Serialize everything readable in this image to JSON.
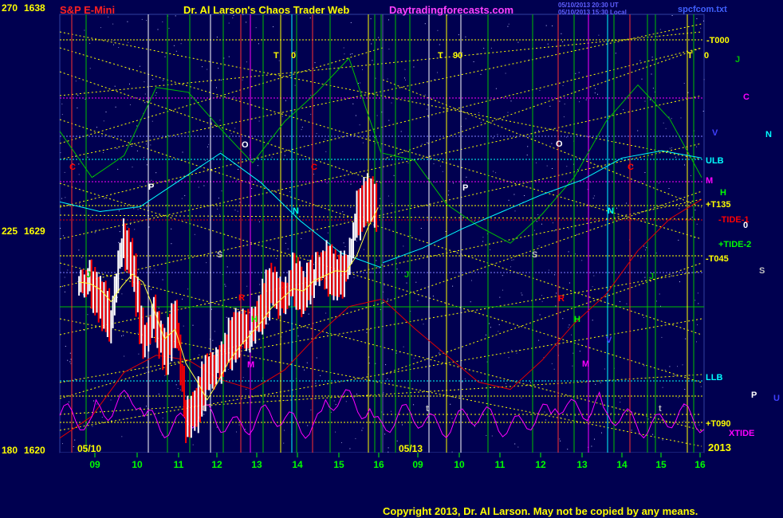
{
  "header": {
    "symbol": "S&P E-Mini",
    "title": "Dr. Al Larson's Chaos Trader Web",
    "site": "Daytradingforecasts.com",
    "timestamp_line1": "05/10/2013 20:30 UT",
    "timestamp_line2": "05/10/2013 15:30 Local",
    "file": "spcfcom.txt"
  },
  "copyright": "Copyright 2013, Dr. Al Larson. May not be copied by any means.",
  "colors": {
    "background": "#000050",
    "price_up": "#ffffff",
    "price_down": "#ff0000",
    "green_line": "#00c000",
    "yellow_dotted": "#ffff00",
    "cyan": "#00ffff",
    "magenta": "#ff00ff",
    "red": "#e00000",
    "blue": "#8080ff"
  },
  "chart_data": {
    "type": "line",
    "title": "S&P E-Mini",
    "price_axis": {
      "ticks": [
        {
          "angle": "270",
          "price": "1638"
        },
        {
          "angle": "225",
          "price": "1629"
        },
        {
          "angle": "180",
          "price": "1620"
        }
      ],
      "ylim": [
        1620,
        1638
      ]
    },
    "date_labels": [
      "05/10",
      "05/13"
    ],
    "year_label": "2013",
    "hours_panel_1": [
      "09",
      "10",
      "11",
      "12",
      "13",
      "14",
      "15",
      "16"
    ],
    "hours_panel_2": [
      "09",
      "10",
      "11",
      "12",
      "13",
      "14",
      "15",
      "16"
    ],
    "right_labels": [
      {
        "text": "-T000",
        "color": "#ffff00"
      },
      {
        "text": "J",
        "color": "#00c000"
      },
      {
        "text": "C",
        "color": "#ff00ff"
      },
      {
        "text": "V",
        "color": "#4040ff"
      },
      {
        "text": "N",
        "color": "#00ffff"
      },
      {
        "text": "ULB",
        "color": "#00ffff"
      },
      {
        "text": "M",
        "color": "#ff00ff"
      },
      {
        "text": "H",
        "color": "#00ff00"
      },
      {
        "text": "+T135",
        "color": "#ffff00"
      },
      {
        "text": "-TIDE-1",
        "color": "#ff0000"
      },
      {
        "text": "0",
        "color": "#ffffff"
      },
      {
        "text": "+TIDE-2",
        "color": "#00ff00"
      },
      {
        "text": "-T045",
        "color": "#ffff00"
      },
      {
        "text": "S",
        "color": "#c0c0c0"
      },
      {
        "text": "LLB",
        "color": "#00ffff"
      },
      {
        "text": "P",
        "color": "#ffffff"
      },
      {
        "text": "U",
        "color": "#4040ff"
      },
      {
        "text": "+T090",
        "color": "#ffff00"
      },
      {
        "text": "XTIDE",
        "color": "#ff00ff"
      }
    ],
    "chart_letters": [
      {
        "text": "T",
        "color": "#ffff00"
      },
      {
        "text": "0",
        "color": "#ffff00"
      },
      {
        "text": "T",
        "color": "#ffff00"
      },
      {
        "text": "90",
        "color": "#ffff00"
      },
      {
        "text": "T",
        "color": "#ffff00"
      },
      {
        "text": "0",
        "color": "#ffff00"
      },
      {
        "text": "C",
        "color": "#ff0000"
      },
      {
        "text": "O",
        "color": "#ffffff"
      },
      {
        "text": "C",
        "color": "#ff0000"
      },
      {
        "text": "P",
        "color": "#ffffff"
      },
      {
        "text": "N",
        "color": "#00ffff"
      },
      {
        "text": "S",
        "color": "#c0c0c0"
      },
      {
        "text": "J",
        "color": "#00c000"
      },
      {
        "text": "R",
        "color": "#ff0000"
      },
      {
        "text": "H",
        "color": "#00ff00"
      },
      {
        "text": "M",
        "color": "#ff00ff"
      },
      {
        "text": "t",
        "color": "#c0c0c0"
      },
      {
        "text": "O",
        "color": "#ffffff"
      },
      {
        "text": "P",
        "color": "#ffffff"
      },
      {
        "text": "C",
        "color": "#ff0000"
      },
      {
        "text": "N",
        "color": "#00ffff"
      },
      {
        "text": "S",
        "color": "#c0c0c0"
      },
      {
        "text": "J",
        "color": "#00c000"
      },
      {
        "text": "R",
        "color": "#ff0000"
      },
      {
        "text": "H",
        "color": "#00ff00"
      },
      {
        "text": "M",
        "color": "#ff00ff"
      },
      {
        "text": "V",
        "color": "#4040ff"
      },
      {
        "text": "J",
        "color": "#00c000"
      },
      {
        "text": "t",
        "color": "#c0c0c0"
      },
      {
        "text": "t",
        "color": "#c0c0c0"
      }
    ],
    "price_bars_session_1": {
      "hours": [
        9,
        9.25,
        9.5,
        9.75,
        10,
        10.25,
        10.5,
        10.75,
        11,
        11.25,
        11.5,
        11.75,
        12,
        12.25,
        12.5,
        12.75,
        13,
        13.25,
        13.5,
        13.75,
        14,
        14.25,
        14.5,
        14.75,
        15,
        15.25,
        15.5,
        15.75,
        16
      ],
      "close": [
        1627.0,
        1626.9,
        1626.2,
        1625.5,
        1628.8,
        1627.7,
        1624.5,
        1625.5,
        1624.0,
        1625.7,
        1621.3,
        1621.9,
        1623.3,
        1623.5,
        1624.4,
        1625.1,
        1625.0,
        1625.9,
        1626.9,
        1626.2,
        1627.1,
        1626.6,
        1627.5,
        1627.7,
        1627.2,
        1627.4,
        1629.7,
        1630.5,
        1630.0
      ]
    },
    "green_wave": [
      1633.2,
      1631.3,
      1632.2,
      1635.0,
      1634.8,
      1633.3,
      1631.9,
      1633.6,
      1634.8,
      1636.2,
      1632.3,
      1632.0,
      1630.2,
      1629.3,
      1628.6,
      1629.8,
      1631.3,
      1633.6,
      1635.1,
      1633.7,
      1631.3
    ],
    "red_wave": [
      1620.6,
      1621.5,
      1623.3,
      1624.0,
      1623.8,
      1623.0,
      1622.6,
      1623.4,
      1624.8,
      1626.0,
      1626.3,
      1625.1,
      1624.0,
      1622.9,
      1622.6,
      1623.8,
      1625.3,
      1626.5,
      1628.3,
      1629.6,
      1630.4
    ],
    "blue_wave": [
      1630.3,
      1629.9,
      1630.1,
      1631.2,
      1632.3,
      1631.1,
      1629.5,
      1628.2,
      1627.6,
      1627.8,
      1628.4,
      1629.2,
      1629.9,
      1630.6,
      1631.2,
      1632.1,
      1632.4,
      1632.1
    ]
  }
}
